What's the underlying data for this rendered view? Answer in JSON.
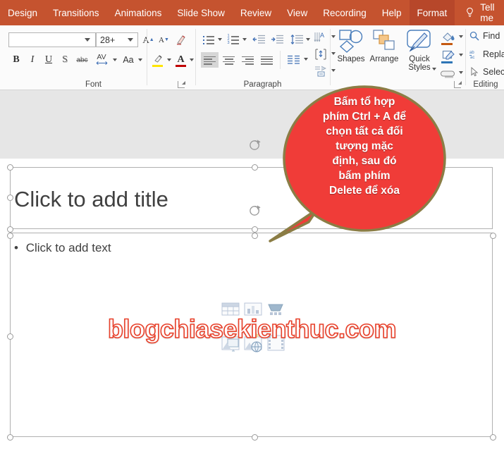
{
  "tabs": [
    {
      "label": "Design",
      "active": false
    },
    {
      "label": "Transitions",
      "active": false
    },
    {
      "label": "Animations",
      "active": false
    },
    {
      "label": "Slide Show",
      "active": false
    },
    {
      "label": "Review",
      "active": false
    },
    {
      "label": "View",
      "active": false
    },
    {
      "label": "Recording",
      "active": false
    },
    {
      "label": "Help",
      "active": false
    },
    {
      "label": "Format",
      "active": true
    }
  ],
  "tellme": {
    "label": "Tell me",
    "icon": "lightbulb-icon"
  },
  "ribbon": {
    "font": {
      "group_label": "Font",
      "font_name_value": "",
      "font_size_value": "28+",
      "grow_font": "A",
      "shrink_font": "A",
      "clear_formatting": "clear-formatting-icon",
      "bold": "B",
      "italic": "I",
      "underline": "U",
      "shadow": "S",
      "strikethrough": "abc",
      "character_spacing": "AV",
      "change_case": "Aa",
      "highlight_color": "text-highlight-icon",
      "font_color": "A",
      "highlight_swatch": "#ffe600",
      "font_color_swatch": "#c00000"
    },
    "paragraph": {
      "group_label": "Paragraph",
      "bullets": "bullets-icon",
      "numbering": "numbering-icon",
      "decrease_indent": "decrease-indent-icon",
      "increase_indent": "increase-indent-icon",
      "line_spacing": "line-spacing-icon",
      "text_direction": "text-direction-icon",
      "align_text": "align-text-icon",
      "convert_smartart": "convert-to-smartart-icon",
      "align_left": "align-left-icon",
      "align_center": "align-center-icon",
      "align_right": "align-right-icon",
      "justify": "justify-icon",
      "columns": "columns-icon"
    },
    "drawing": {
      "shapes": "Shapes",
      "arrange": "Arrange",
      "quick_styles": "Quick Styles",
      "shape_fill": "shape-fill-icon",
      "shape_outline": "shape-outline-icon",
      "shape_effects": "shape-effects-icon",
      "fill_swatch": "#c55a11",
      "outline_swatch": "#2e75b6"
    },
    "editing": {
      "group_label": "Editing",
      "find": "Find",
      "replace": "Repla",
      "select": "Select"
    }
  },
  "slide": {
    "title_placeholder": "Click to add title",
    "body_bullet": "•",
    "body_placeholder": "Click to add text",
    "content_icons": [
      "insert-table-icon",
      "insert-chart-icon",
      "insert-smartart-icon",
      "insert-pictures-icon",
      "insert-online-pictures-icon",
      "insert-video-icon"
    ]
  },
  "watermark": {
    "text": "blogchiasekienthuc.com",
    "color": "#e8402a"
  },
  "callout": {
    "lines": [
      "Bấm tổ hợp",
      "phím Ctrl + A để",
      "chọn tất cả đối",
      "tượng mặc",
      "định, sau đó",
      "bấm phím",
      "Delete để xóa"
    ],
    "fill": "#f03c38",
    "border": "#8b7d45"
  },
  "colors": {
    "ribbon_accent": "#c5532f",
    "active_tab": "#b7472a",
    "workspace_gray": "#e6e6e6"
  }
}
